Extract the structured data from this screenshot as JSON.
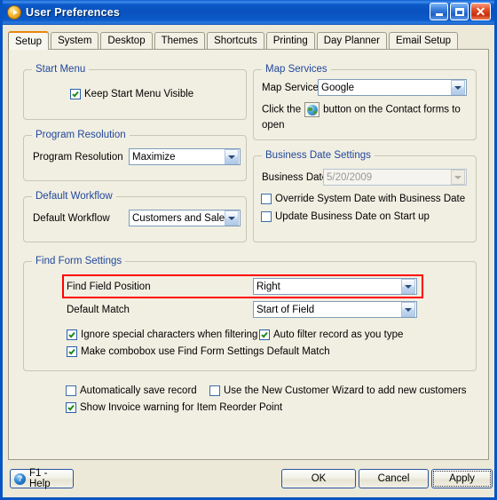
{
  "window": {
    "title": "User Preferences",
    "icon": "play-circle-icon",
    "buttons": {
      "minimize": "minimize-button",
      "maximize": "maximize-button",
      "close": "close-button"
    }
  },
  "tabs": [
    {
      "label": "Setup",
      "active": true
    },
    {
      "label": "System",
      "active": false
    },
    {
      "label": "Desktop",
      "active": false
    },
    {
      "label": "Themes",
      "active": false
    },
    {
      "label": "Shortcuts",
      "active": false
    },
    {
      "label": "Printing",
      "active": false
    },
    {
      "label": "Day Planner",
      "active": false
    },
    {
      "label": "Email Setup",
      "active": false
    }
  ],
  "groups": {
    "start_menu": {
      "title": "Start Menu",
      "keep_visible_label": "Keep Start Menu Visible",
      "keep_visible_checked": true
    },
    "program_resolution": {
      "title": "Program Resolution",
      "field_label": "Program Resolution",
      "value": "Maximize"
    },
    "default_workflow": {
      "title": "Default Workflow",
      "field_label": "Default Workflow",
      "value": "Customers and Sales"
    },
    "map_services": {
      "title": "Map Services",
      "field_label": "Map Service",
      "value": "Google",
      "hint_before": "Click the",
      "hint_after": "button on the Contact forms to open",
      "hint_icon": "globe-icon"
    },
    "business_date": {
      "title": "Business Date Settings",
      "field_label": "Business Date",
      "value": "5/20/2009",
      "disabled": true,
      "override_label": "Override System Date with Business Date",
      "override_checked": false,
      "update_label": "Update Business Date on Start up",
      "update_checked": false
    },
    "find_form": {
      "title": "Find Form Settings",
      "find_field_position_label": "Find Field Position",
      "find_field_position_value": "Right",
      "default_match_label": "Default Match",
      "default_match_value": "Start of Field",
      "ignore_special_label": "Ignore special characters when filtering",
      "ignore_special_checked": true,
      "auto_filter_label": "Auto filter record as you type",
      "auto_filter_checked": true,
      "combobox_match_label": "Make combobox use Find Form Settings Default Match",
      "combobox_match_checked": true,
      "highlight_color": "#FF0000"
    }
  },
  "footer_options": {
    "auto_save_label": "Automatically save record",
    "auto_save_checked": false,
    "wizard_label": "Use the New Customer Wizard to add new customers",
    "wizard_checked": false,
    "reorder_label": "Show Invoice warning for Item Reorder Point",
    "reorder_checked": true
  },
  "buttonbar": {
    "help_label": "F1 - Help",
    "help_icon": "question-circle-icon",
    "ok_label": "OK",
    "cancel_label": "Cancel",
    "apply_label": "Apply",
    "focused": "Apply"
  }
}
